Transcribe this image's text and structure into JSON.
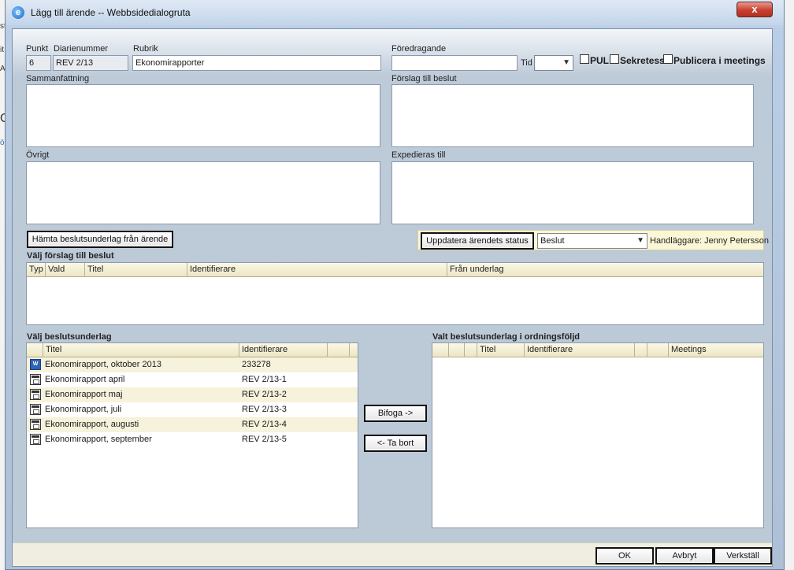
{
  "window": {
    "title": "Lägg till ärende -- Webbsidedialogruta",
    "close_label": "x"
  },
  "fields": {
    "punkt_label": "Punkt",
    "punkt_value": "6",
    "diarienummer_label": "Diarienummer",
    "diarienummer_value": "REV 2/13",
    "rubrik_label": "Rubrik",
    "rubrik_value": "Ekonomirapporter",
    "foredragande_label": "Föredragande",
    "foredragande_value": "",
    "tid_label": "Tid",
    "tid_value": "",
    "pul_label": "PUL",
    "sekretess_label": "Sekretess",
    "publicera_label": "Publicera i meetings",
    "sammanfattning_label": "Sammanfattning",
    "forslag_label": "Förslag till beslut",
    "ovrigt_label": "Övrigt",
    "expedieras_label": "Expedieras till"
  },
  "actions": {
    "hamta_label": "Hämta beslutsunderlag från ärende",
    "uppdatera_label": "Uppdatera ärendets status",
    "status_value": "Beslut",
    "handlaggare_text": "Handläggare: Jenny Petersson"
  },
  "forslag_grid": {
    "title": "Välj förslag till beslut",
    "columns": [
      "Typ",
      "Vald",
      "Titel",
      "Identifierare",
      "Från underlag"
    ]
  },
  "underlag_grid": {
    "title": "Välj beslutsunderlag",
    "columns": [
      "",
      "Titel",
      "Identifierare",
      "",
      ""
    ],
    "rows": [
      {
        "icon": "word-document-icon",
        "titel": "Ekonomirapport, oktober 2013",
        "id": "233278"
      },
      {
        "icon": "document-icon",
        "titel": "Ekonomirapport april",
        "id": "REV 2/13-1"
      },
      {
        "icon": "document-icon",
        "titel": "Ekonomirapport maj",
        "id": "REV 2/13-2"
      },
      {
        "icon": "document-icon",
        "titel": "Ekonomirapport, juli",
        "id": "REV 2/13-3"
      },
      {
        "icon": "document-icon",
        "titel": "Ekonomirapport, augusti",
        "id": "REV 2/13-4"
      },
      {
        "icon": "document-icon",
        "titel": "Ekonomirapport, september",
        "id": "REV 2/13-5"
      }
    ]
  },
  "transfer": {
    "bifoga_label": "Bifoga ->",
    "tabort_label": "<- Ta bort"
  },
  "valt_grid": {
    "title": "Valt beslutsunderlag i ordningsföljd",
    "columns": [
      "",
      "",
      "",
      "Titel",
      "Identifierare",
      "",
      "",
      "Meetings"
    ]
  },
  "footer": {
    "ok_label": "OK",
    "avbryt_label": "Avbryt",
    "verkstall_label": "Verkställ"
  },
  "background": {
    "left_fragments": [
      "st",
      "it",
      "A",
      "O",
      "ö"
    ]
  }
}
